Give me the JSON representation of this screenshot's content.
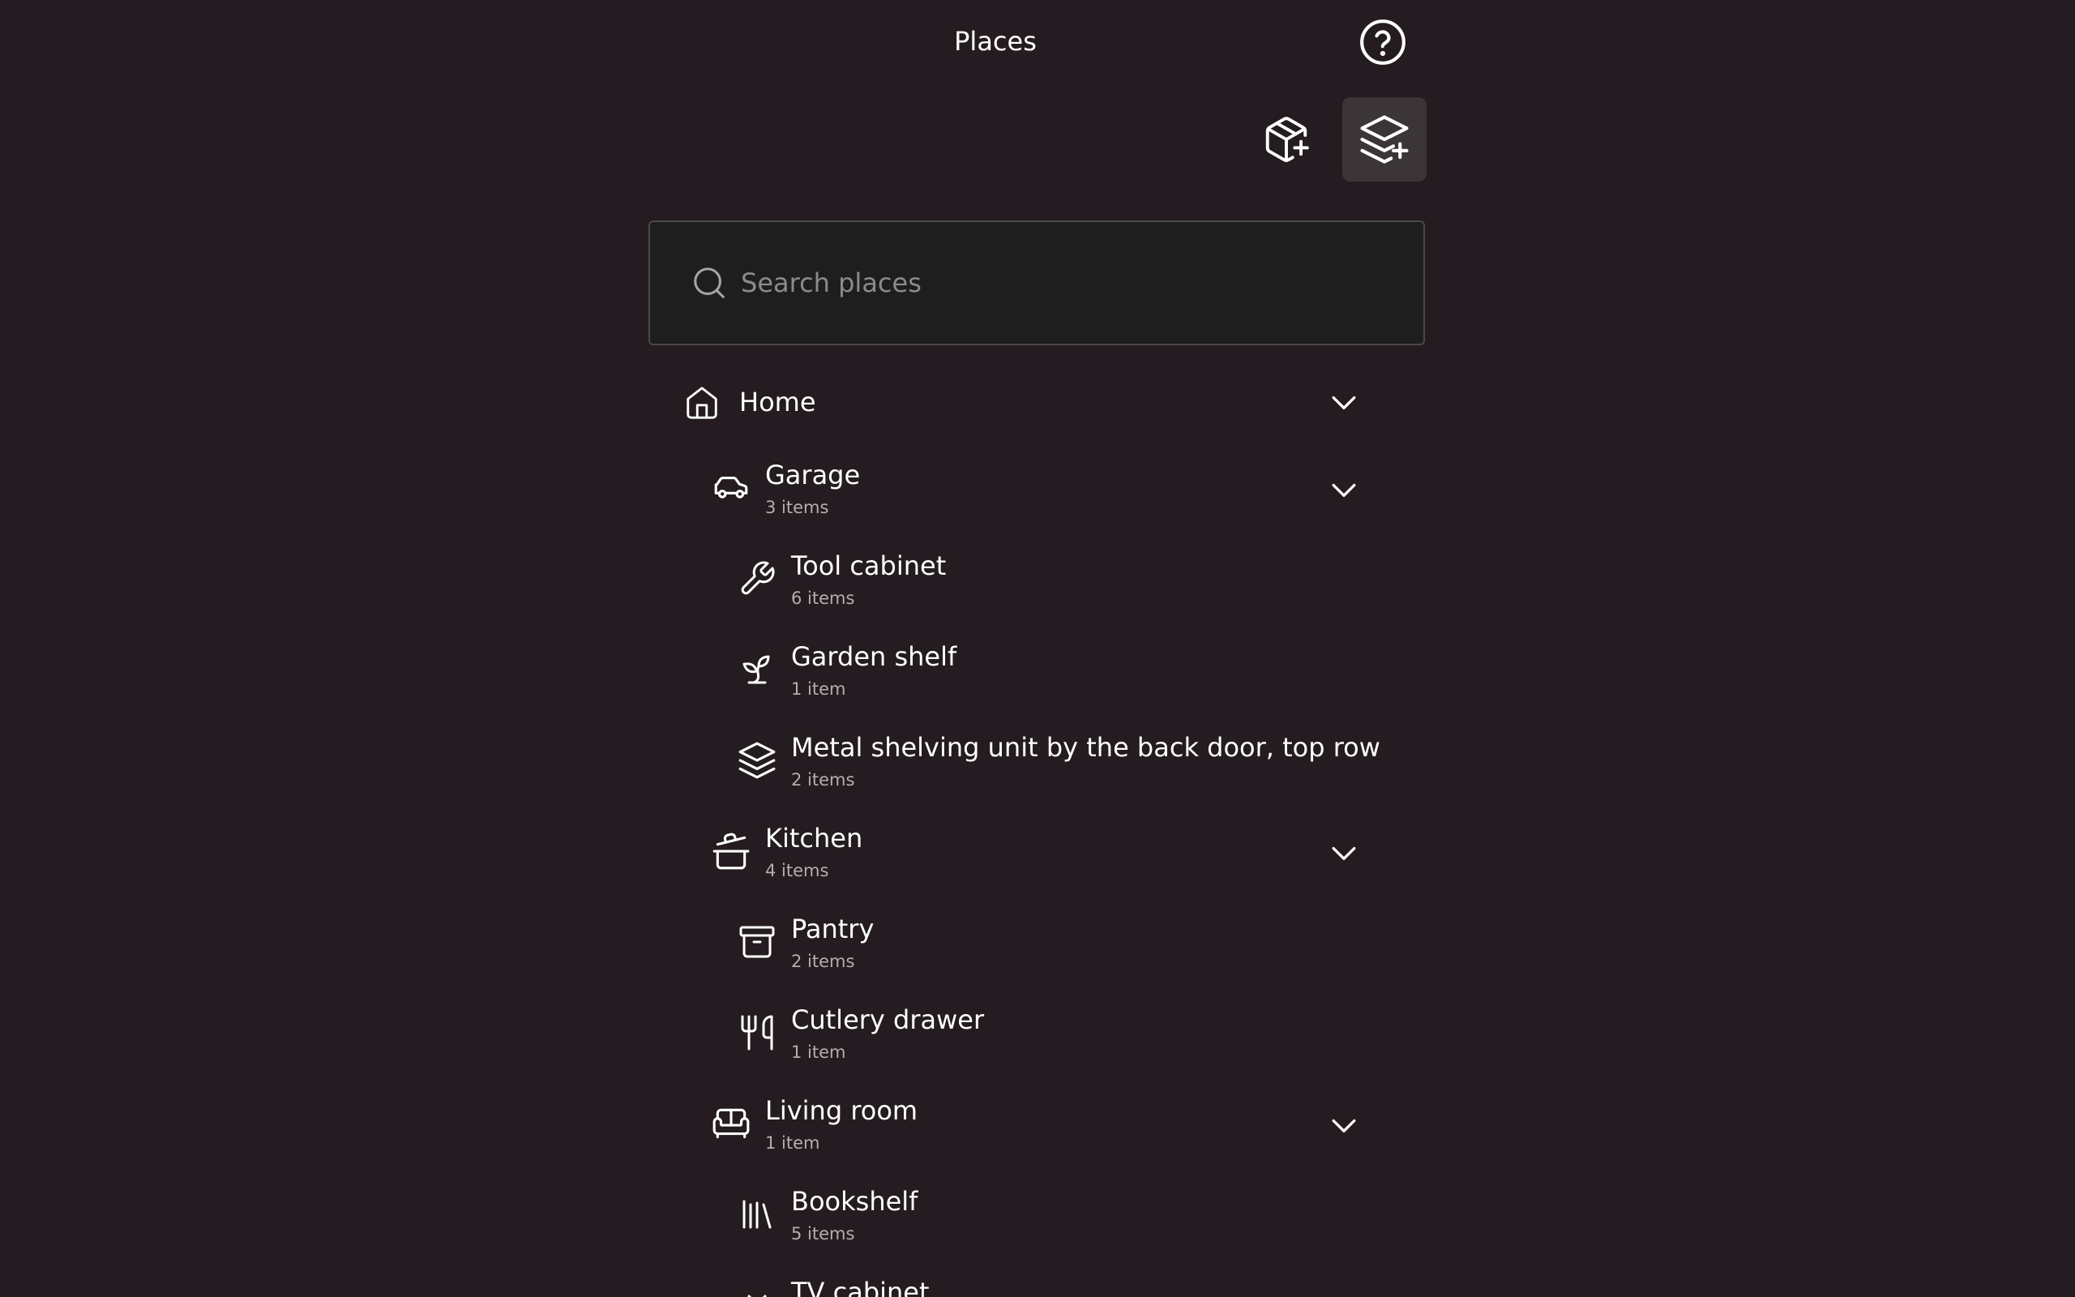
{
  "header": {
    "title": "Places"
  },
  "search": {
    "placeholder": "Search places",
    "value": ""
  },
  "tree": {
    "root": {
      "name": "Home",
      "icon": "home-icon"
    },
    "garage": {
      "name": "Garage",
      "count": "3 items",
      "icon": "car-icon",
      "children": [
        {
          "name": "Tool cabinet",
          "count": "6 items",
          "icon": "wrench-icon"
        },
        {
          "name": "Garden shelf",
          "count": "1 item",
          "icon": "sprout-icon"
        },
        {
          "name": "Metal shelving unit by the back door, top row",
          "count": "2 items",
          "icon": "layers-icon"
        }
      ]
    },
    "kitchen": {
      "name": "Kitchen",
      "count": "4 items",
      "icon": "cooking-pot-icon",
      "children": [
        {
          "name": "Pantry",
          "count": "2 items",
          "icon": "archive-box-icon"
        },
        {
          "name": "Cutlery drawer",
          "count": "1 item",
          "icon": "utensils-icon"
        }
      ]
    },
    "living_room": {
      "name": "Living room",
      "count": "1 item",
      "icon": "sofa-icon",
      "children": [
        {
          "name": "Bookshelf",
          "count": "5 items",
          "icon": "library-icon"
        },
        {
          "name": "TV cabinet",
          "count": "",
          "icon": "chevron-down-icon"
        }
      ]
    }
  },
  "colors": {
    "background": "#241c20",
    "search_background": "#1e1e1e",
    "active_button": "#3b3538",
    "text": "#ffffff",
    "secondary_text": "#b3aeb0"
  }
}
